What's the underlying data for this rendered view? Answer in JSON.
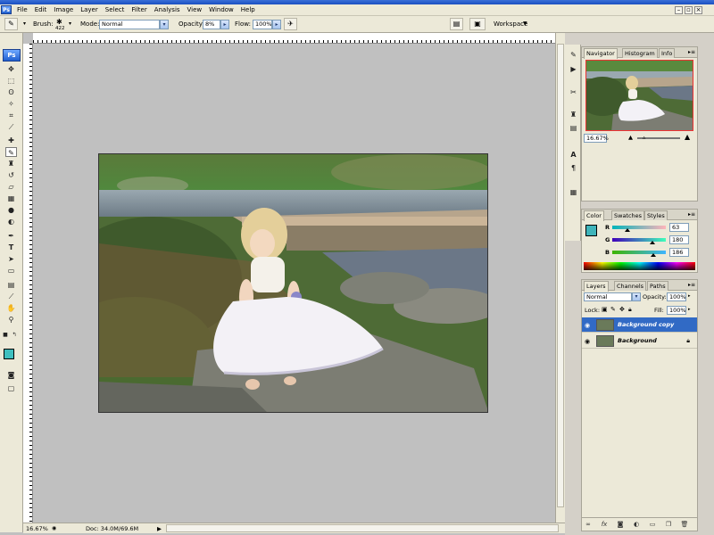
{
  "menu": {
    "logo_text": "Ps",
    "items": [
      "File",
      "Edit",
      "Image",
      "Layer",
      "Select",
      "Filter",
      "Analysis",
      "View",
      "Window",
      "Help"
    ]
  },
  "options": {
    "brush_label": "Brush:",
    "brush_size": "422",
    "mode_label": "Mode:",
    "mode_value": "Normal",
    "opacity_label": "Opacity:",
    "opacity_value": "8%",
    "flow_label": "Flow:",
    "flow_value": "100%",
    "workspace_label": "Workspace"
  },
  "toolbox": {
    "logo_text": "Ps"
  },
  "status": {
    "zoom": "16.67%",
    "doc": "Doc: 34.0M/69.6M"
  },
  "navigator": {
    "tabs": [
      "Navigator",
      "Histogram",
      "Info"
    ],
    "zoom": "16.67%"
  },
  "color": {
    "tabs": [
      "Color",
      "Swatches",
      "Styles"
    ],
    "r": "63",
    "g": "180",
    "b": "186",
    "foreground": "#3fb4ba"
  },
  "layers": {
    "tabs": [
      "Layers",
      "Channels",
      "Paths"
    ],
    "blend_mode": "Normal",
    "opacity_label": "Opacity:",
    "opacity_value": "100%",
    "lock_label": "Lock:",
    "fill_label": "Fill:",
    "fill_value": "100%",
    "items": [
      {
        "name": "Background copy",
        "selected": true
      },
      {
        "name": "Background",
        "selected": false
      }
    ]
  }
}
